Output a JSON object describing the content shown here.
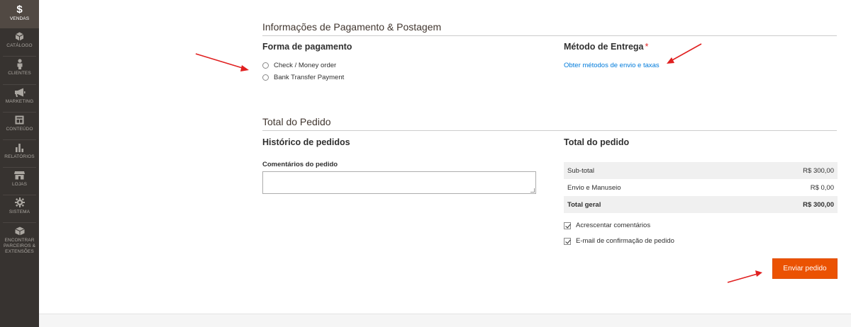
{
  "sidebar": {
    "items": [
      {
        "label": "VENDAS",
        "icon": "dollar-icon"
      },
      {
        "label": "CATÁLOGO",
        "icon": "cube-icon"
      },
      {
        "label": "CLIENTES",
        "icon": "person-icon"
      },
      {
        "label": "MARKETING",
        "icon": "megaphone-icon"
      },
      {
        "label": "CONTEÚDO",
        "icon": "layout-icon"
      },
      {
        "label": "RELATÓRIOS",
        "icon": "bar-chart-icon"
      },
      {
        "label": "LOJAS",
        "icon": "store-icon"
      },
      {
        "label": "SISTEMA",
        "icon": "gear-icon"
      },
      {
        "label": "ENCONTRAR PARCEIROS & EXTENSÕES",
        "icon": "box-icon"
      }
    ]
  },
  "payment_shipping": {
    "title": "Informações de Pagamento & Postagem",
    "payment_method_title": "Forma de pagamento",
    "options": [
      "Check / Money order",
      "Bank Transfer Payment"
    ],
    "shipping_method_title": "Método de Entrega",
    "required_marker": "*",
    "shipping_link": "Obter métodos de envio e taxas"
  },
  "order_total": {
    "title": "Total do Pedido",
    "history_title": "Histórico de pedidos",
    "comments_label": "Comentários do pedido",
    "comments_value": "",
    "totals_title": "Total do pedido",
    "rows": [
      {
        "label": "Sub-total",
        "value": "R$ 300,00"
      },
      {
        "label": "Envio e Manuseio",
        "value": "R$ 0,00"
      },
      {
        "label": "Total geral",
        "value": "R$ 300,00"
      }
    ],
    "checkboxes": [
      {
        "label": "Acrescentar comentários",
        "checked": true
      },
      {
        "label": "E-mail de confirmação de pedido",
        "checked": true
      }
    ],
    "submit_label": "Enviar pedido"
  },
  "colors": {
    "sidebar_bg": "#373330",
    "sidebar_active": "#514943",
    "accent": "#eb5202",
    "link": "#007bdb",
    "annotation_arrow": "#e02020"
  }
}
